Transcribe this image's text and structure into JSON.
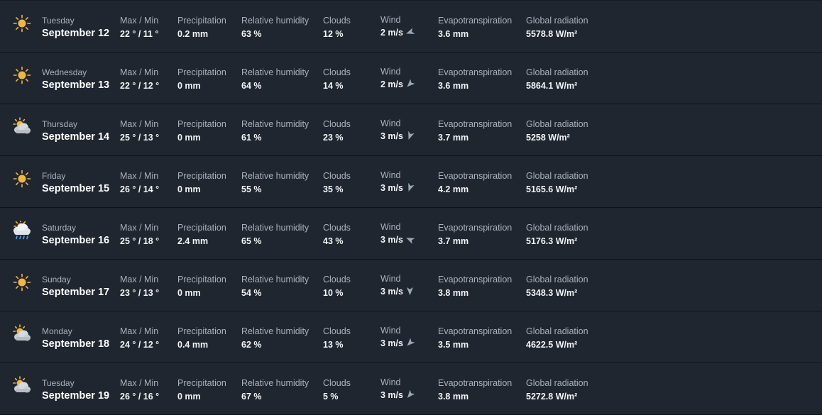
{
  "labels": {
    "max_min": "Max / Min",
    "precipitation": "Precipitation",
    "humidity": "Relative humidity",
    "clouds": "Clouds",
    "wind": "Wind",
    "evapotranspiration": "Evapotranspiration",
    "radiation": "Global radiation"
  },
  "colors": {
    "row_bg": "#1f2630",
    "separator": "#0e1319",
    "label": "#a9b2bc",
    "value": "#f2f4f6",
    "sun": "#f0b548",
    "cloud": "#c8ccd2",
    "rain": "#4aa3e8",
    "arrow": "#9aa6b6"
  },
  "days": [
    {
      "weekday": "Tuesday",
      "date": "September 12",
      "icon": "sun-icon",
      "maxmin": "22 ° / 11 °",
      "precipitation": "0.2 mm",
      "humidity": "63 %",
      "clouds": "12 %",
      "wind": "2 m/s",
      "wind_dir_deg": 250,
      "evapotranspiration": "3.6 mm",
      "radiation": "5578.8 W/m²"
    },
    {
      "weekday": "Wednesday",
      "date": "September 13",
      "icon": "sun-icon",
      "maxmin": "22 ° / 12 °",
      "precipitation": "0 mm",
      "humidity": "64 %",
      "clouds": "14 %",
      "wind": "2 m/s",
      "wind_dir_deg": 225,
      "evapotranspiration": "3.6 mm",
      "radiation": "5864.1 W/m²"
    },
    {
      "weekday": "Thursday",
      "date": "September 14",
      "icon": "sun-behind-cloud-icon",
      "maxmin": "25 ° / 13 °",
      "precipitation": "0 mm",
      "humidity": "61 %",
      "clouds": "23 %",
      "wind": "3 m/s",
      "wind_dir_deg": 200,
      "evapotranspiration": "3.7 mm",
      "radiation": "5258 W/m²"
    },
    {
      "weekday": "Friday",
      "date": "September 15",
      "icon": "sun-icon",
      "maxmin": "26 ° / 14 °",
      "precipitation": "0 mm",
      "humidity": "55 %",
      "clouds": "35 %",
      "wind": "3 m/s",
      "wind_dir_deg": 200,
      "evapotranspiration": "4.2 mm",
      "radiation": "5165.6 W/m²"
    },
    {
      "weekday": "Saturday",
      "date": "September 16",
      "icon": "sun-cloud-rain-icon",
      "maxmin": "25 ° / 18 °",
      "precipitation": "2.4 mm",
      "humidity": "65 %",
      "clouds": "43 %",
      "wind": "3 m/s",
      "wind_dir_deg": 295,
      "evapotranspiration": "3.7 mm",
      "radiation": "5176.3 W/m²"
    },
    {
      "weekday": "Sunday",
      "date": "September 17",
      "icon": "sun-icon",
      "maxmin": "23 ° / 13 °",
      "precipitation": "0 mm",
      "humidity": "54 %",
      "clouds": "10 %",
      "wind": "3 m/s",
      "wind_dir_deg": 180,
      "evapotranspiration": "3.8 mm",
      "radiation": "5348.3 W/m²"
    },
    {
      "weekday": "Monday",
      "date": "September 18",
      "icon": "sun-behind-cloud-icon",
      "maxmin": "24 ° / 12 °",
      "precipitation": "0.4 mm",
      "humidity": "62 %",
      "clouds": "13 %",
      "wind": "3 m/s",
      "wind_dir_deg": 225,
      "evapotranspiration": "3.5 mm",
      "radiation": "4622.5 W/m²"
    },
    {
      "weekday": "Tuesday",
      "date": "September 19",
      "icon": "sun-behind-cloud-icon",
      "maxmin": "26 ° / 16 °",
      "precipitation": "0 mm",
      "humidity": "67 %",
      "clouds": "5 %",
      "wind": "3 m/s",
      "wind_dir_deg": 220,
      "evapotranspiration": "3.8 mm",
      "radiation": "5272.8 W/m²"
    }
  ]
}
